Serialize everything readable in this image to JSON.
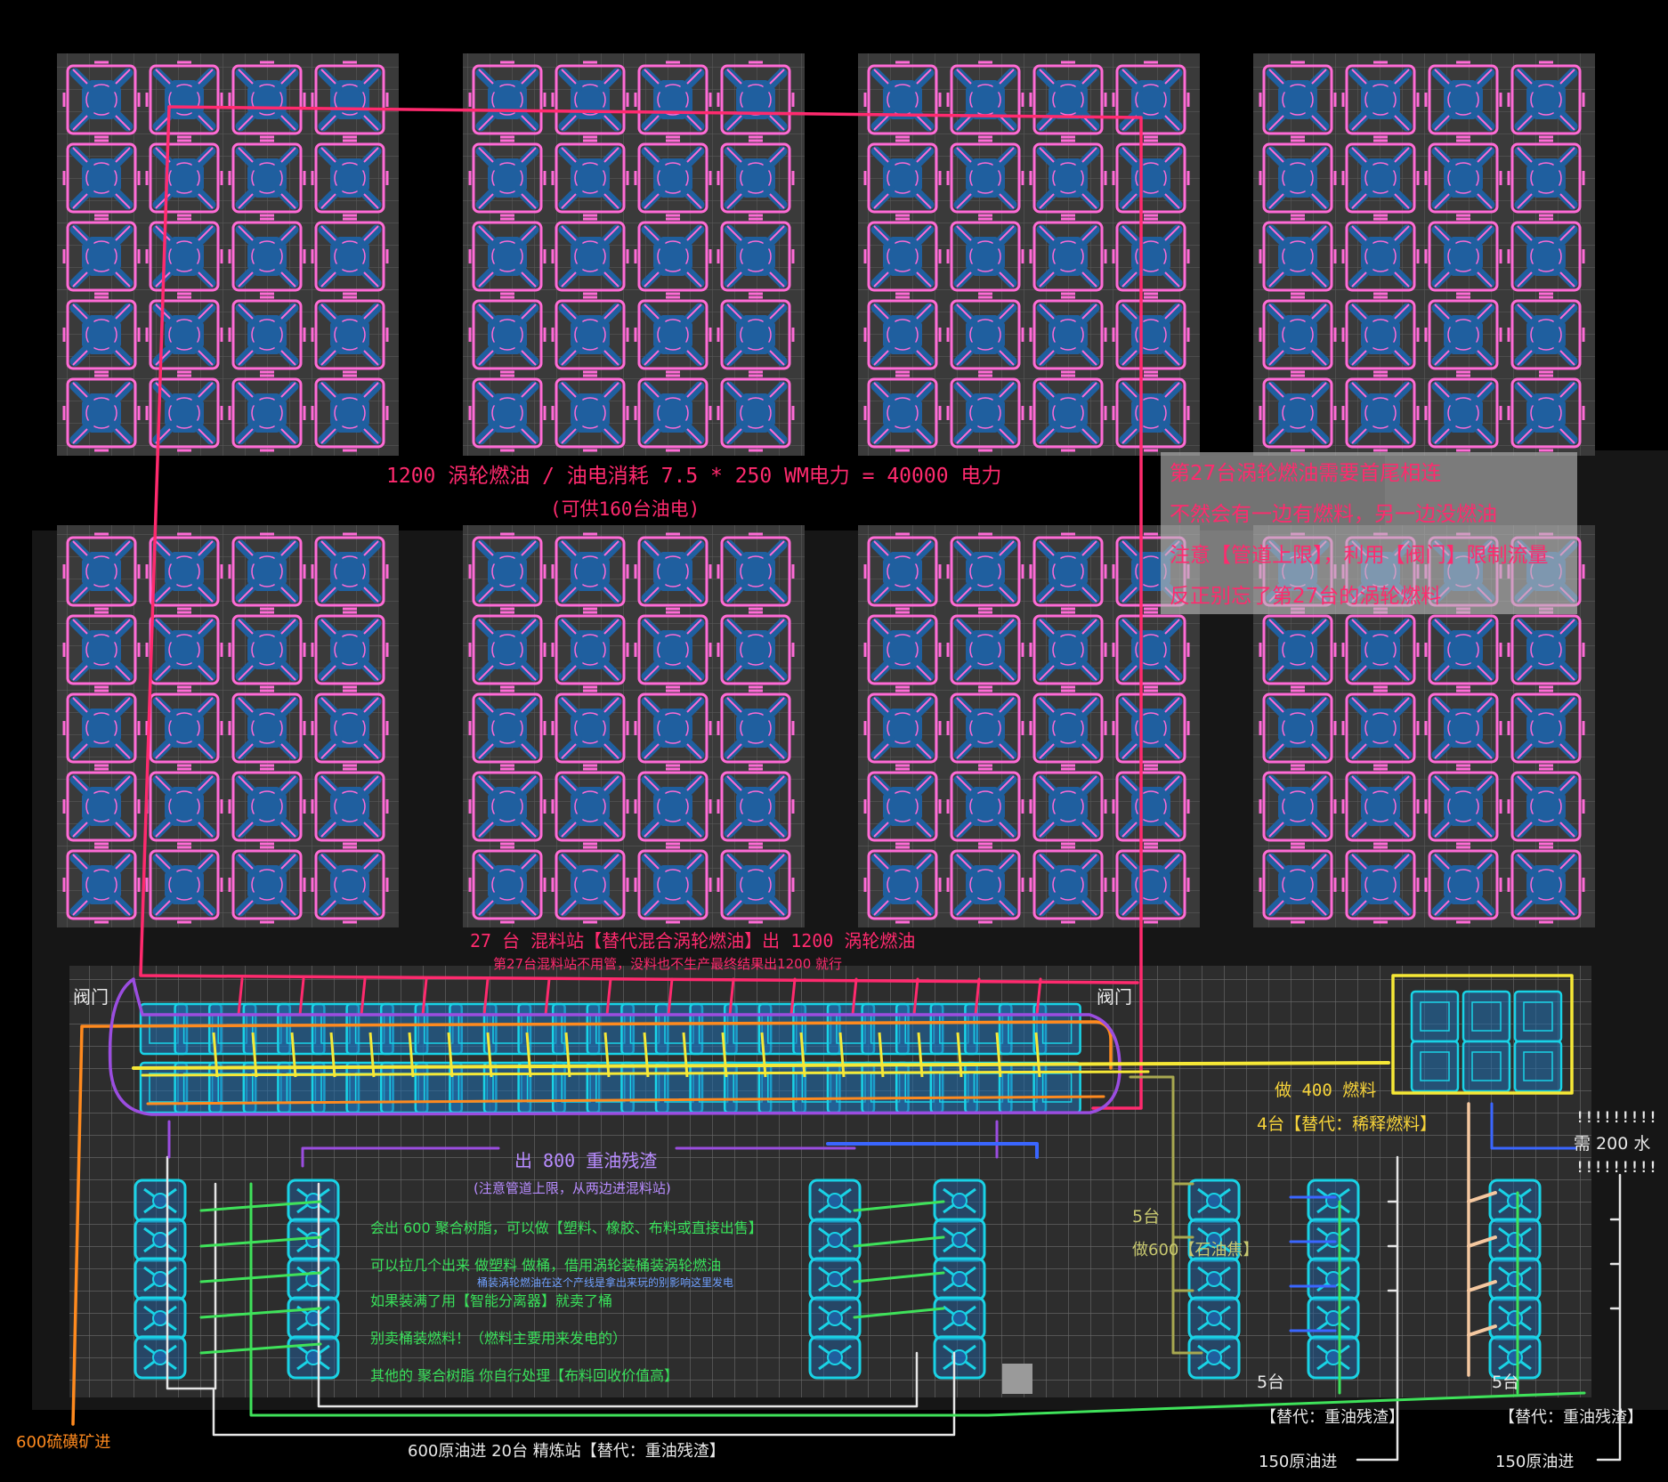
{
  "colors": {
    "bg": "#000000",
    "panel": "#3a3a3a",
    "grid": "#5e5e5e",
    "turbine_fill": "#1f5f9f",
    "turbine_outline": "#ff6bd6",
    "machine_outline": "#19d3e6",
    "pipe_pink": "#ff2a6e",
    "pipe_yellow": "#f6e836",
    "pipe_orange": "#ff8a1e",
    "pipe_purple": "#9b4de0",
    "pipe_green": "#3fe25a",
    "pipe_white": "#e6e6e6",
    "pipe_olive": "#a8a850",
    "pipe_blue": "#3a66ff"
  },
  "labels": {
    "power_title": "1200 涡轮燃油 / 油电消耗 7.5 * 250 WM电力 = 40000 电力",
    "power_sub": "(可供160台油电)",
    "mixer_title": "27 台 混料站【替代混合涡轮燃油】出 1200 涡轮燃油",
    "mixer_sub": "第27台混料站不用管，没料也不生产最终结果出1200 就行",
    "valve_left": "阀门",
    "valve_right": "阀门",
    "heavy_out": "出 800 重油残渣",
    "heavy_note": "(注意管道上限，从两边进混料站)",
    "resin_1": "会出 600 聚合树脂，可以做【塑料、橡胶、布料或直接出售】",
    "resin_2": "可以拉几个出来 做塑料 做桶，借用涡轮装桶装涡轮燃油",
    "resin_small": "桶装涡轮燃油在这个产线是拿出来玩的别影响这里发电",
    "resin_3": "如果装满了用【智能分离器】就卖了桶",
    "resin_4": "别卖桶装燃料！（燃料主要用来发电的）",
    "resin_5": "其他的 聚合树脂 你自行处理【布料回收价值高】",
    "fuel_400": "做 400 燃料",
    "dilute": "4台【替代：稀释燃料】",
    "water_bang_top": "!!!!!!!!!",
    "water": "需 200 水",
    "water_bang_bottom": "!!!!!!!!!",
    "coke_count": "5台",
    "coke": "做600【石油焦】",
    "left_5": "5台",
    "right_5": "5台",
    "left_alt": "【替代：重油残渣】",
    "right_alt": "【替代：重油残渣】",
    "left_crude": "150原油进",
    "right_crude": "150原油进",
    "sulfur": "600硫磺矿进",
    "refinery": "600原油进 20台 精炼站【替代：重油残渣】"
  },
  "notes": [
    "第27台涡轮燃油需要首尾相连",
    "不然会有一边有燃料，另一边没燃油",
    "注意【管道上限】，利用【阀门】限制流量",
    "反正别忘了第27台的涡轮燃料"
  ]
}
